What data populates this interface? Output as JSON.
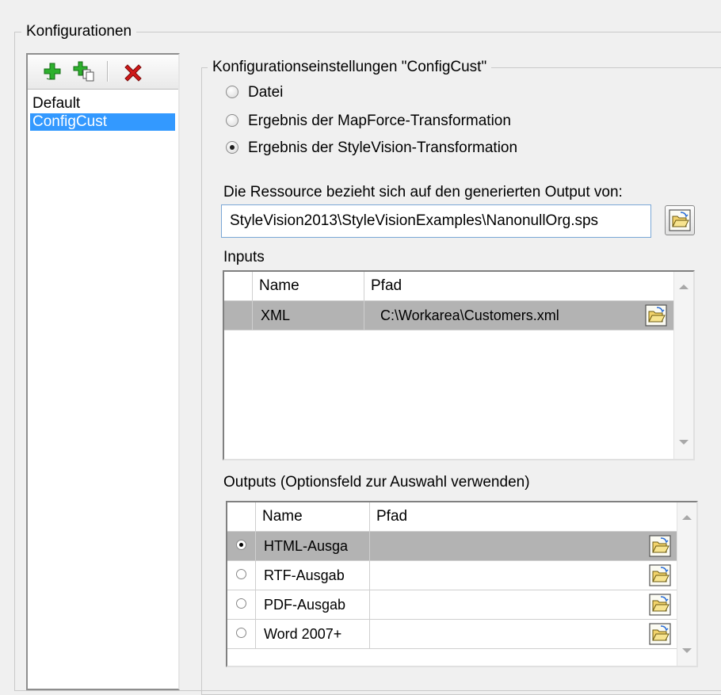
{
  "konfigurationen": {
    "title": "Konfigurationen",
    "toolbar": {
      "add_icon": "add-plus-icon",
      "add_copy_icon": "add-copy-icon",
      "delete_icon": "delete-x-icon"
    },
    "items": [
      {
        "label": "Default",
        "selected": false
      },
      {
        "label": "ConfigCust",
        "selected": true
      }
    ]
  },
  "settings": {
    "title": "Konfigurationseinstellungen \"ConfigCust\"",
    "radios": [
      {
        "label": "Datei",
        "checked": false
      },
      {
        "label": "Ergebnis der MapForce-Transformation",
        "checked": false
      },
      {
        "label": "Ergebnis der StyleVision-Transformation",
        "checked": true
      }
    ],
    "resource_label": "Die Ressource bezieht sich auf den generierten Output von:",
    "resource_value": "StyleVision2013\\StyleVisionExamples\\NanonullOrg.sps"
  },
  "inputs": {
    "title": "Inputs",
    "columns": [
      "Name",
      "Pfad"
    ],
    "rows": [
      {
        "name": "XML",
        "path": "C:\\Workarea\\Customers.xml",
        "selected": true
      }
    ]
  },
  "outputs": {
    "title": "Outputs (Optionsfeld zur Auswahl verwenden)",
    "columns": [
      "Name",
      "Pfad"
    ],
    "rows": [
      {
        "name": "HTML-Ausga",
        "path": "",
        "selected": true
      },
      {
        "name": "RTF-Ausgab",
        "path": "",
        "selected": false
      },
      {
        "name": "PDF-Ausgab",
        "path": "",
        "selected": false
      },
      {
        "name": "Word 2007+",
        "path": "",
        "selected": false
      }
    ]
  },
  "colors": {
    "selection": "#3399ff",
    "row_selection": "#b3b3b3",
    "add_green": "#2db02d",
    "delete_red": "#d01818"
  }
}
